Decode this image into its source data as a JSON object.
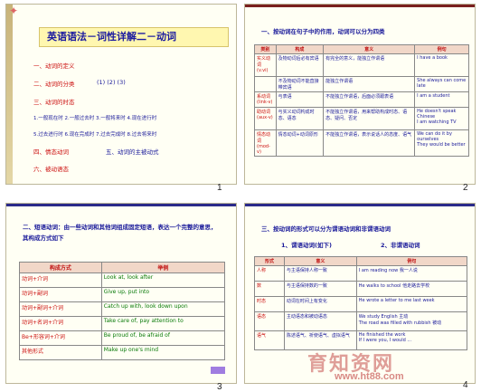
{
  "slide1": {
    "number": "1",
    "title": "英语语法－词性详解二－动词",
    "items": [
      "一、动词的定义",
      "二、动词的分类",
      "三、动词的时态"
    ],
    "class_nums": "(1)  (2)  (3)",
    "tense_row1": "1.一般现在时 2.一般过去时 3.一般将来时 4.现在进行时",
    "tense_row2": "5.过去进行时 6.现在完成时 7.过去完成时 8.过去将来时",
    "item4": "四、情态动词",
    "item4b": "五、动词的主被动式",
    "item6": "六、被动语态"
  },
  "slide2": {
    "number": "2",
    "heading": "一、按动词在句子中的作用，动词可以分为四类",
    "columns": [
      "类别",
      "构成",
      "意义",
      "例句"
    ],
    "rows": [
      {
        "cat": "实义动词\n(v.vi)",
        "form": "及物动词后必有宾语",
        "meaning": "有完全的意义，能独立作谓语",
        "ex": "I have a book"
      },
      {
        "cat": "",
        "form": "不及物动词不能直接带宾语",
        "meaning": "能独立作谓语",
        "ex": "She always can come late"
      },
      {
        "cat": "系动词\n(link-v)",
        "form": "与表语",
        "meaning": "不能独立作谓语，后面必须跟表语",
        "ex": "I am a student"
      },
      {
        "cat": "助动词\n(aux-v)",
        "form": "与实义动词构成时态、语态",
        "meaning": "不能独立作谓语，用来帮助构成时态、语态、疑问、否定",
        "ex": "He doesn't speak Chinese\nI am watching TV"
      },
      {
        "cat": "情态动词\n(mod-v)",
        "form": "情态动词+动词原形",
        "meaning": "不能独立作谓语，表示说话人的态度、语气",
        "ex": "We can do it by ourselves\nThey would be better"
      }
    ]
  },
  "slide3": {
    "number": "3",
    "heading": "二、短语动词：由一些动词和其他词组成固定短语，表达一个完整的意思，其构成方式如下",
    "columns": [
      "构成方式",
      "举例"
    ],
    "rows": [
      {
        "form": "动词+介词",
        "ex": "Look at, look after"
      },
      {
        "form": "动词+副词",
        "ex": "Give up, put into"
      },
      {
        "form": "动词+副词+介词",
        "ex": "Catch up with, look down upon"
      },
      {
        "form": "动词+名词+介词",
        "ex": "Take care of, pay attention to"
      },
      {
        "form": "Be+形容词+介词",
        "ex": "Be proud of, be afraid of"
      },
      {
        "form": "其他形式",
        "ex": "Make up one's mind"
      }
    ]
  },
  "slide4": {
    "number": "4",
    "heading": "三、按动词的形式可以分为谓语动词和非谓语动词",
    "subheading1": "1、谓语动词(如下)",
    "subheading2": "2、非谓语动词",
    "columns": [
      "形式",
      "意义",
      "例句"
    ],
    "rows": [
      {
        "form": "人称",
        "meaning": "与主语保持人称一致",
        "ex": "I am reading now 我一人说"
      },
      {
        "form": "数",
        "meaning": "与主语保持数的一致",
        "ex": "He walks to school 他走路去学校"
      },
      {
        "form": "时态",
        "meaning": "动词在时间上有变化",
        "ex": "He wrote a letter to me last week"
      },
      {
        "form": "语态",
        "meaning": "主动语态和被动语态",
        "ex": "We study English 主动\nThe road was filled with rubbish 被动"
      },
      {
        "form": "语气",
        "meaning": "陈述语气、祈使语气、虚拟语气",
        "ex": "He finished the work\nIf I were you, I would ..."
      }
    ]
  },
  "watermark": {
    "line1": "育知资网",
    "line2": "www.ht88.com"
  }
}
